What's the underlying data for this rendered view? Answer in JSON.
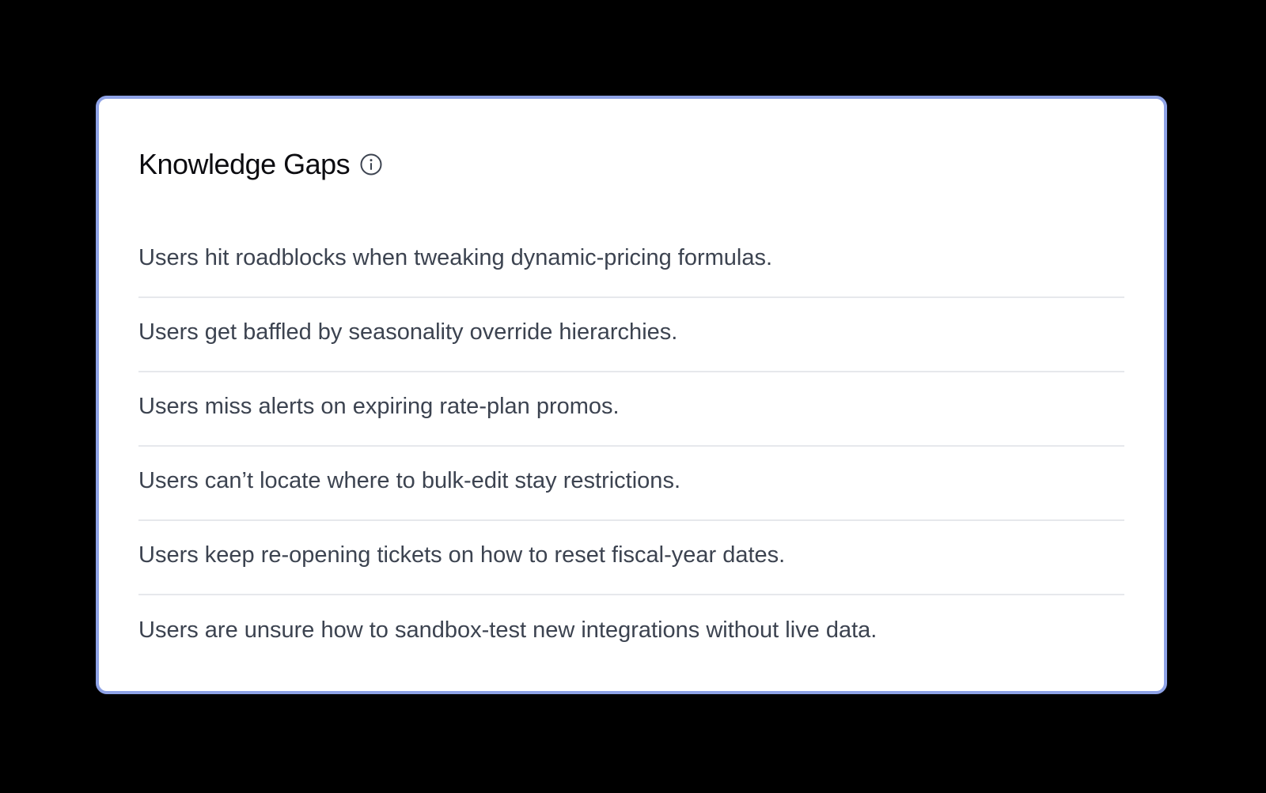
{
  "card": {
    "title": "Knowledge Gaps",
    "info_icon": "info-circle-icon",
    "accent_color": "#8ea2e6"
  },
  "gaps": [
    {
      "text": "Users hit roadblocks when tweaking dynamic-pricing formulas."
    },
    {
      "text": "Users get baffled by seasonality override hierarchies."
    },
    {
      "text": "Users miss alerts on expiring rate-plan promos."
    },
    {
      "text": "Users can’t locate where to bulk-edit stay restrictions."
    },
    {
      "text": "Users keep re-opening tickets on how to reset fiscal-year dates."
    },
    {
      "text": "Users are unsure how to sandbox-test new integrations without live data."
    }
  ]
}
